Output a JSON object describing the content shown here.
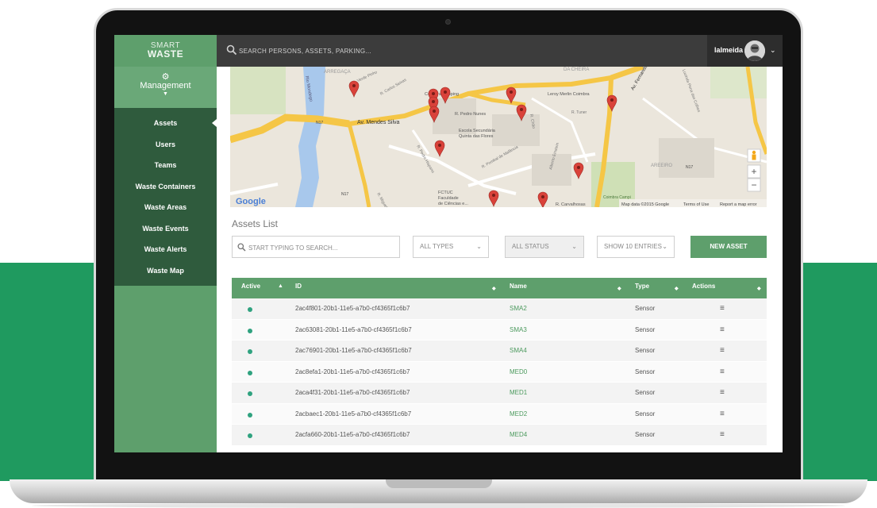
{
  "sidebar": {
    "brand_line1": "SMART",
    "brand_line2": "WASTE",
    "section_label": "Management",
    "items": [
      {
        "label": "Assets",
        "active": true
      },
      {
        "label": "Users"
      },
      {
        "label": "Teams"
      },
      {
        "label": "Waste Containers"
      },
      {
        "label": "Waste Areas"
      },
      {
        "label": "Waste Events"
      },
      {
        "label": "Waste Alerts"
      },
      {
        "label": "Waste Map"
      }
    ]
  },
  "topbar": {
    "search_placeholder": "SEARCH PERSONS, ASSETS, PARKING...",
    "username": "lalmeida"
  },
  "map": {
    "labels": {
      "arregaca": "ARREGAÇA",
      "verde_pinho": "R. Verde Pinho",
      "carlos_seixas": "R. Carlos Seixas",
      "rio_mondego": "Rio Mondego",
      "n17_a": "N17",
      "mendes_silva": "Av. Mendes Silva",
      "coimbrashopping": "Coimbrashopping",
      "pedro_nunes": "R. Pedro Nunes",
      "chao": "R. Chão",
      "tuner": "R. Tuner",
      "leroy": "Leroy Merlin Coimbra",
      "escola_1": "Escola Secundária",
      "escola_2": "Quinta das Flores",
      "pedro_hispano": "R. Pedro Hispano",
      "pombal": "R. Pombal de Mafância",
      "fctuc_1": "FCTUC",
      "fctuc_2": "Faculdade",
      "fctuc_3": "de Ciências e...",
      "miguel": "R. Miguel...",
      "alberto": "Alberto Einstein",
      "carvalhosas": "R. Carvalhosas",
      "coimbra_campi": "Coimbra Campi",
      "areeiro": "AREEIRO",
      "n17_b": "N17",
      "n17_c": "N17",
      "cheira": "DA CHEIRA",
      "fernando": "Av. Fernando...",
      "lucinda": "Lucinda Pena das Colhes",
      "google": "Google",
      "map_data": "Map data ©2015 Google",
      "terms": "Terms of Use",
      "report": "Report a map error"
    },
    "zoom_in": "+",
    "zoom_out": "−"
  },
  "assets": {
    "title": "Assets List",
    "search_placeholder": "START TYPING TO SEARCH...",
    "type_filter": "ALL TYPES",
    "status_filter": "ALL STATUS",
    "entries_filter": "SHOW 10 ENTRIES",
    "new_button": "NEW ASSET",
    "columns": {
      "active": "Active",
      "id": "ID",
      "name": "Name",
      "type": "Type",
      "actions": "Actions"
    },
    "rows": [
      {
        "id": "2ac4f801-20b1-11e5-a7b0-cf4365f1c6b7",
        "name": "SMA2",
        "type": "Sensor",
        "active": true
      },
      {
        "id": "2ac63081-20b1-11e5-a7b0-cf4365f1c6b7",
        "name": "SMA3",
        "type": "Sensor",
        "active": true
      },
      {
        "id": "2ac76901-20b1-11e5-a7b0-cf4365f1c6b7",
        "name": "SMA4",
        "type": "Sensor",
        "active": true
      },
      {
        "id": "2ac8efa1-20b1-11e5-a7b0-cf4365f1c6b7",
        "name": "MED0",
        "type": "Sensor",
        "active": true
      },
      {
        "id": "2aca4f31-20b1-11e5-a7b0-cf4365f1c6b7",
        "name": "MED1",
        "type": "Sensor",
        "active": true
      },
      {
        "id": "2acbaec1-20b1-11e5-a7b0-cf4365f1c6b7",
        "name": "MED2",
        "type": "Sensor",
        "active": true
      },
      {
        "id": "2acfa660-20b1-11e5-a7b0-cf4365f1c6b7",
        "name": "MED4",
        "type": "Sensor",
        "active": true
      }
    ]
  },
  "colors": {
    "brand_green": "#5e9f6c",
    "sidebar_dark": "#2f5b3d",
    "page_band_green": "#1f9a5f",
    "topbar": "#3c3c3c",
    "active_dot": "#2fa27f",
    "map_marker": "#d9423a"
  },
  "icons": {
    "search": "search-icon",
    "gear": "gear-icon",
    "menu": "hamburger-icon",
    "chevron": "chevron-down-icon",
    "pegman": "pegman-icon",
    "marker": "map-marker-icon"
  }
}
